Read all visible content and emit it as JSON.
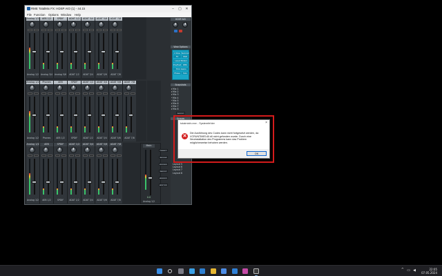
{
  "totalmix": {
    "title": "RME TotalMix FX: HDSP AIO (1) - 44.1k",
    "menu": [
      "File",
      "Function",
      "Options",
      "Window",
      "Help"
    ],
    "input_row": {
      "strips": [
        {
          "label": "Analog 1/2",
          "name": "Analog 1/2"
        },
        {
          "label": "AEB 1/2",
          "name": "Analog 3/4"
        },
        {
          "label": "SPDIF",
          "name": "Analog 5/6"
        },
        {
          "label": "ADAT 1/2",
          "name": "ADAT 1/2"
        },
        {
          "label": "ADAT 3/4",
          "name": "ADAT 3/4"
        },
        {
          "label": "ADAT 5/6",
          "name": "ADAT 5/6"
        },
        {
          "label": "ADAT 7/8",
          "name": "ADAT 7/8"
        }
      ]
    },
    "playback_row": {
      "strips": [
        {
          "label": "Analog 1/2",
          "name": "Analog 1/2"
        },
        {
          "label": "Phones",
          "name": "Phones"
        },
        {
          "label": "AEB",
          "name": "AEB 1/2"
        },
        {
          "label": "SPDIF",
          "name": "SPDIF"
        },
        {
          "label": "ADAT 1/2",
          "name": "ADAT 1/2"
        },
        {
          "label": "ADAT 3/4",
          "name": "ADAT 3/4"
        },
        {
          "label": "ADAT 5/6",
          "name": "ADAT 5/6"
        },
        {
          "label": "ADAT 7/8",
          "name": "ADAT 7/8"
        }
      ]
    },
    "output_row": {
      "strips": [
        {
          "label": "Analog 1/2",
          "name": "Analog 1/2"
        },
        {
          "label": "AEB",
          "name": "AEB 1/2"
        },
        {
          "label": "SPDIF",
          "name": "SPDIF"
        },
        {
          "label": "ADAT 1/2",
          "name": "ADAT 1/2"
        },
        {
          "label": "ADAT 3/4",
          "name": "ADAT 3/4"
        },
        {
          "label": "ADAT 5/6",
          "name": "ADAT 5/6"
        },
        {
          "label": "ADAT 7/8",
          "name": "ADAT 7/8"
        }
      ]
    },
    "master": {
      "label": "Main",
      "value": "0.0",
      "name": "Analog 1/2"
    },
    "master_buttons": [
      "Dim",
      "Recall",
      "Speaker B",
      "Mono",
      "Talkback",
      "Ext. Input"
    ],
    "right_panel": {
      "device_label": "HDSP AIO",
      "view_options": "View Options",
      "teal_buttons": [
        "2 Row",
        "Submix",
        "FX",
        "PAN",
        "Level Meters",
        "Pre/Post",
        "RMS",
        "Trim Gains",
        "Phase",
        "Solo"
      ],
      "snapshots_header": "Snapshots",
      "snapshots": [
        "Mix 1",
        "Mix 2",
        "Mix 3",
        "Mix 4",
        "Mix 5",
        "Mix 6",
        "Mix 7",
        "Mix 8"
      ],
      "store_label": "Store",
      "groups_header": "Groups",
      "layouts": [
        "Layout 5",
        "Layout 6",
        "Layout 7",
        "Layout 8"
      ]
    }
  },
  "dialog": {
    "title": "totalmixfx.exe - Systemfehler",
    "close": "×",
    "message_lines": [
      "Die Ausführung des Codes kann nicht fortgesetzt werden, da",
      "VCRUNTIME140.dll nicht gefunden wurde. Durch eine",
      "Neuinstallation des Programms kann das Problem",
      "möglicherweise behoben werden."
    ],
    "ok_label": "OK",
    "highlight_color": "#d51b1b"
  },
  "taskbar": {
    "apps": [
      "start-icon",
      "search-icon",
      "task-view-icon",
      "widgets-icon",
      "edge-icon",
      "file-explorer-icon",
      "store-icon",
      "mail-icon",
      "photos-icon",
      "totalmix-icon"
    ],
    "tray_chevron": "^",
    "time": "22:05",
    "date": "07.05.2024"
  }
}
